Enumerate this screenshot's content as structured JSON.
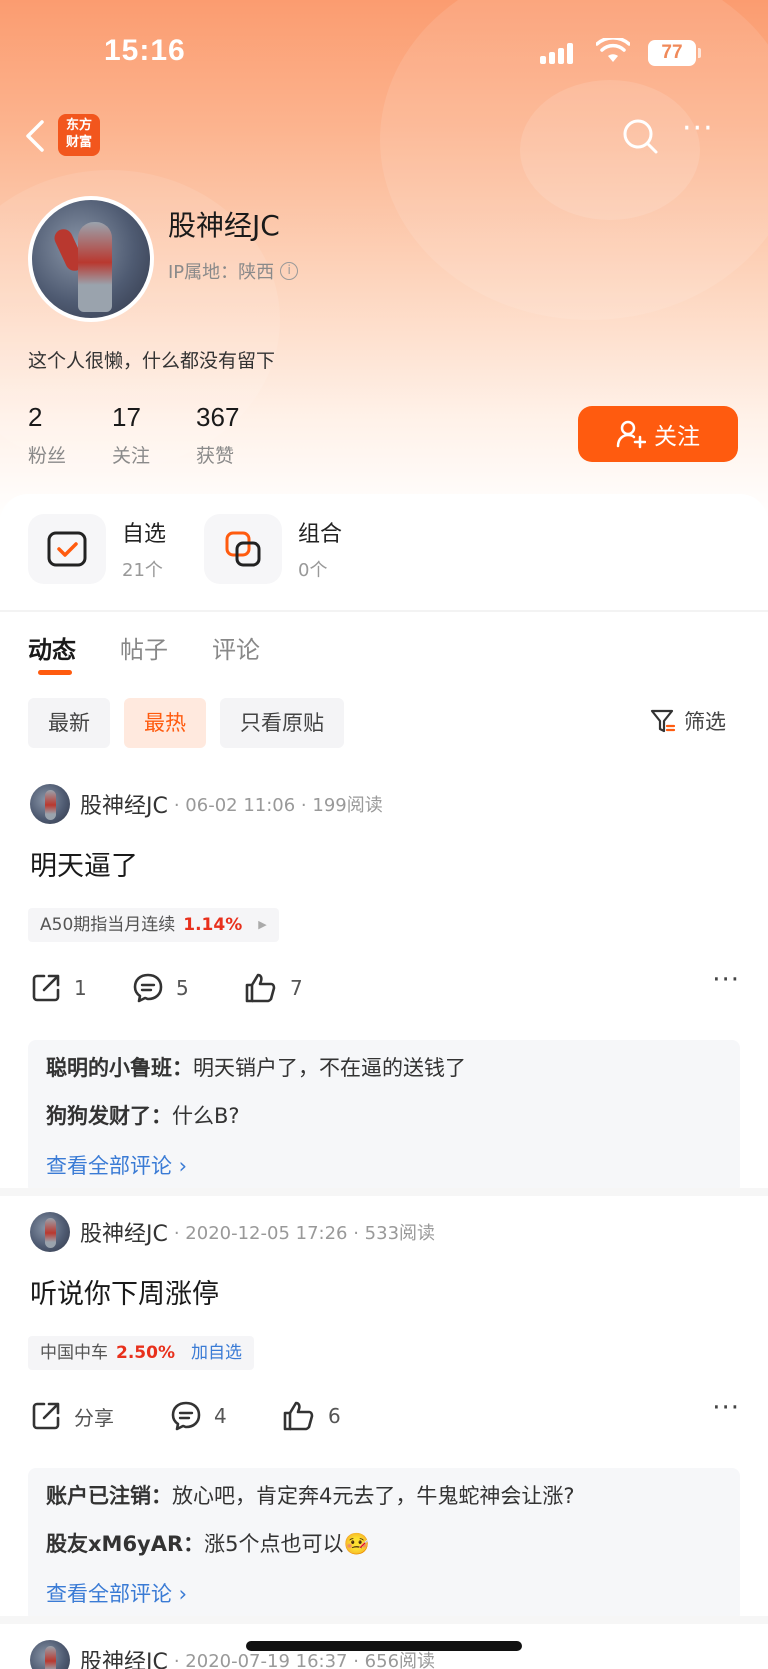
{
  "status_bar": {
    "time": "15:16",
    "battery": "77"
  },
  "nav": {
    "logo_line1": "东方",
    "logo_line2": "财富"
  },
  "profile": {
    "username": "股神经JC",
    "ip_label": "IP属地：陕西",
    "bio": "这个人很懒，什么都没有留下",
    "stats": [
      {
        "value": "2",
        "label": "粉丝"
      },
      {
        "value": "17",
        "label": "关注"
      },
      {
        "value": "367",
        "label": "获赞"
      }
    ],
    "follow_label": "关注"
  },
  "shortcuts": [
    {
      "title": "自选",
      "count": "21个"
    },
    {
      "title": "组合",
      "count": "0个"
    }
  ],
  "tabs": [
    {
      "label": "动态",
      "active": true
    },
    {
      "label": "帖子",
      "active": false
    },
    {
      "label": "评论",
      "active": false
    }
  ],
  "filters": [
    {
      "label": "最新",
      "active": false
    },
    {
      "label": "最热",
      "active": true
    },
    {
      "label": "只看原贴",
      "active": false
    }
  ],
  "filter_button": "筛选",
  "posts": [
    {
      "author": "股神经JC",
      "meta": "· 06-02 11:06 · 199阅读",
      "title": "明天逼了",
      "stock": {
        "name": "A50期指当月连续",
        "change": "1.14%",
        "extra": ""
      },
      "actions": {
        "share": "1",
        "comments": "5",
        "likes": "7"
      },
      "comments": [
        {
          "who": "聪明的小鲁班：",
          "text": "明天销户了，不在逼的送钱了"
        },
        {
          "who": "狗狗发财了：",
          "text": "什么B?"
        }
      ],
      "see_all": "查看全部评论 ›"
    },
    {
      "author": "股神经JC",
      "meta": "· 2020-12-05 17:26 · 533阅读",
      "title": "听说你下周涨停",
      "stock": {
        "name": "中国中车",
        "change": "2.50%",
        "extra": "加自选"
      },
      "actions": {
        "share": "分享",
        "comments": "4",
        "likes": "6"
      },
      "comments": [
        {
          "who": "账户已注销：",
          "text": "放心吧，肯定奔4元去了，牛鬼蛇神会让涨?"
        },
        {
          "who": "股友xM6yAR：",
          "text": "涨5个点也可以🤒"
        }
      ],
      "see_all": "查看全部评论 ›"
    },
    {
      "author": "股神经JC",
      "meta": "· 2020-07-19 16:37 · 656阅读"
    }
  ],
  "colors": {
    "accent": "#ff5b0f",
    "link": "#3a7bd5",
    "price_up": "#e8301c"
  }
}
